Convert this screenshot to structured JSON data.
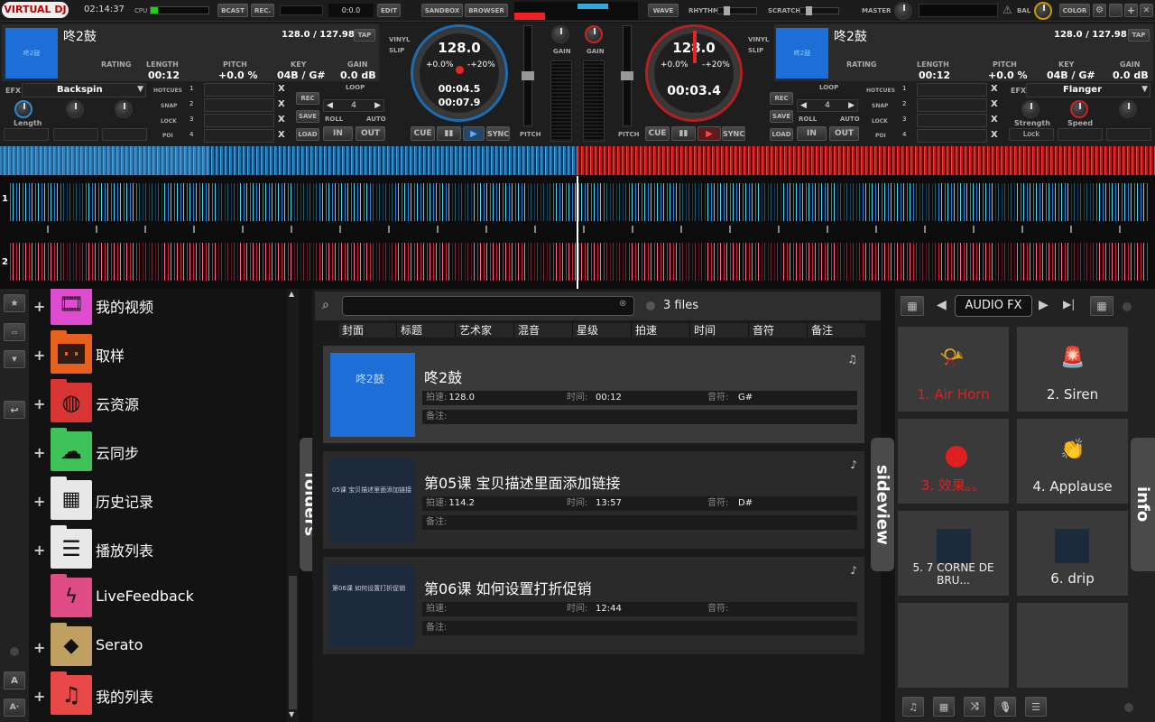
{
  "topbar": {
    "logo": "VIRTUAL DJ",
    "time": "02:14:37",
    "cpu": "CPU",
    "bcast": "BCAST",
    "rec": "REC.",
    "counter": "0:0.0",
    "edit": "EDIT",
    "sandbox": "SANDBOX",
    "browser": "BROWSER",
    "wave": "WAVE",
    "rhythm": "RHYTHM",
    "scratch": "SCRATCH",
    "master": "MASTER",
    "bal": "BAL",
    "color": "COLOR"
  },
  "deck1": {
    "title": "咚2鼓",
    "bpm": "128.0 / 127.98",
    "tap": "TAP",
    "art_text": "咚2鼓",
    "rating": "RATING",
    "length_l": "LENGTH",
    "length": "00:12",
    "pitch_l": "PITCH",
    "pitch": "+0.0 %",
    "key_l": "KEY",
    "key": "04B / G#",
    "gain_l": "GAIN",
    "gain": "0.0 dB",
    "efx": "EFX",
    "effect": "Backspin",
    "fx_knob": "Length",
    "vinyl": "VINYL",
    "slip": "SLIP",
    "jog_bpm": "128.0",
    "jog_pitch": "+0.0%",
    "jog_range": "-+20%",
    "elapsed": "00:04.5",
    "remain": "00:07.9",
    "cue": "CUE",
    "sync": "SYNC",
    "pitch_lbl": "PITCH",
    "gain_lbl": "GAIN"
  },
  "deck2": {
    "title": "咚2鼓",
    "bpm": "128.0 / 127.98",
    "tap": "TAP",
    "art_text": "咚2鼓",
    "rating": "RATING",
    "length_l": "LENGTH",
    "length": "00:12",
    "pitch_l": "PITCH",
    "pitch": "+0.0 %",
    "key_l": "KEY",
    "key": "04B / G#",
    "gain_l": "GAIN",
    "gain": "0.0 dB",
    "efx": "EFX",
    "effect": "Flanger",
    "fx_knob1": "Strength",
    "fx_knob2": "Speed",
    "lock": "Lock",
    "vinyl": "VINYL",
    "slip": "SLIP",
    "jog_bpm": "128.0",
    "jog_pitch": "+0.0%",
    "jog_range": "-+20%",
    "elapsed": "00:03.4",
    "cue": "CUE",
    "sync": "SYNC",
    "pitch_lbl": "PITCH",
    "gain_lbl": "GAIN"
  },
  "pads": {
    "hotcues": "HOTCUES",
    "snap": "SNAP",
    "lock": "LOCK",
    "poi": "POI",
    "loop": "LOOP",
    "rec": "REC",
    "save": "SAVE",
    "load": "LOAD",
    "roll": "ROLL",
    "auto": "AUTO",
    "loop_len": "4",
    "in": "IN",
    "out": "OUT",
    "nums": [
      "1",
      "2",
      "3",
      "4"
    ],
    "x": "X"
  },
  "waves": {
    "deck1_num": "1",
    "deck2_num": "2"
  },
  "folders": {
    "tab": "folders",
    "items": [
      {
        "name": "我的视频",
        "color": "#e04ccf",
        "icon": "film-icon",
        "plus": "+"
      },
      {
        "name": "取样",
        "color": "#e8601e",
        "icon": "grid-icon",
        "plus": "+"
      },
      {
        "name": "云资源",
        "color": "#d93535",
        "icon": "globe-icon",
        "plus": "+"
      },
      {
        "name": "云同步",
        "color": "#3fc25a",
        "icon": "cloud-sync-icon",
        "plus": "+"
      },
      {
        "name": "历史记录",
        "color": "#e8e8e8",
        "icon": "calendar-icon",
        "plus": "+"
      },
      {
        "name": "播放列表",
        "color": "#e8e8e8",
        "icon": "list-icon",
        "plus": "+"
      },
      {
        "name": "LiveFeedback",
        "color": "#e04c86",
        "icon": "lightning-icon",
        "plus": ""
      },
      {
        "name": "Serato",
        "color": "#c0a060",
        "icon": "serato-icon",
        "plus": "+"
      },
      {
        "name": "我的列表",
        "color": "#e84848",
        "icon": "music-note-icon",
        "plus": "+"
      }
    ],
    "az1": "A",
    "az2": "A·"
  },
  "browser": {
    "search_placeholder": "",
    "file_count": "3 files",
    "columns": [
      "封面",
      "标题",
      "艺术家",
      "混音",
      "星级",
      "拍速",
      "时间",
      "音符",
      "备注"
    ],
    "tracks": [
      {
        "title": "咚2鼓",
        "art": "咚2鼓",
        "bpm_l": "拍速:",
        "bpm": "128.0",
        "time_l": "时间:",
        "time": "00:12",
        "key_l": "音符:",
        "key": "G#",
        "note_l": "备注:"
      },
      {
        "title": "第05课 宝贝描述里面添加链接",
        "art": "05课 宝贝描述里面添加链接",
        "bpm_l": "拍速:",
        "bpm": "114.2",
        "time_l": "时间:",
        "time": "13:57",
        "key_l": "音符:",
        "key": "D#",
        "note_l": "备注:"
      },
      {
        "title": "第06课 如何设置打折促销",
        "art": "第06课 如何设置打折促销",
        "bpm_l": "拍速:",
        "bpm": "",
        "time_l": "时间:",
        "time": "12:44",
        "key_l": "音符:",
        "key": "",
        "note_l": "备注:"
      }
    ]
  },
  "sideview": {
    "tab": "sideview",
    "info": "info",
    "mode": "AUDIO FX",
    "pads": [
      {
        "label": "1. Air Horn",
        "color": "#e02020",
        "icon": "horn-icon"
      },
      {
        "label": "2. Siren",
        "color": "#eeeeee",
        "icon": "siren-icon"
      },
      {
        "label": "3. 效果。。",
        "color": "#e02020",
        "icon": "record-icon"
      },
      {
        "label": "4. Applause",
        "color": "#eeeeee",
        "icon": "applause-icon"
      },
      {
        "label": "5. 7 CORNE DE BRU...",
        "color": "#eeeeee",
        "icon": "thumb-icon"
      },
      {
        "label": "6. drip",
        "color": "#eeeeee",
        "icon": "thumb-icon"
      },
      {
        "label": "",
        "color": "#eeeeee",
        "icon": ""
      },
      {
        "label": "",
        "color": "#eeeeee",
        "icon": ""
      }
    ]
  }
}
